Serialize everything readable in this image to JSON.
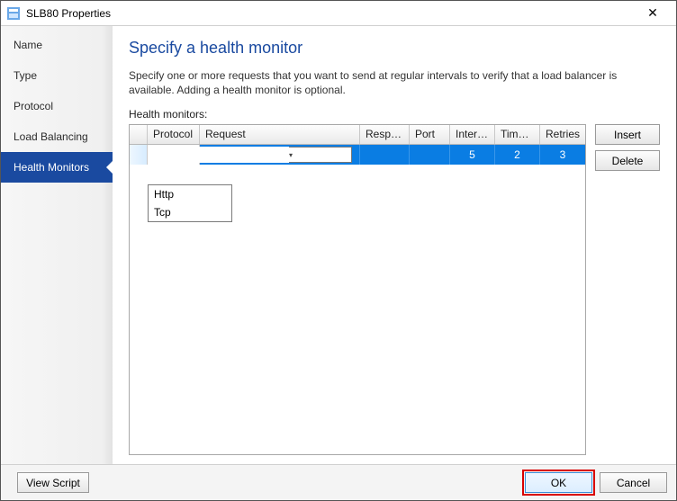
{
  "window": {
    "title": "SLB80 Properties"
  },
  "sidebar": {
    "items": [
      {
        "label": "Name",
        "active": false
      },
      {
        "label": "Type",
        "active": false
      },
      {
        "label": "Protocol",
        "active": false
      },
      {
        "label": "Load Balancing",
        "active": false
      },
      {
        "label": "Health Monitors",
        "active": true
      }
    ]
  },
  "page": {
    "title": "Specify a health monitor",
    "description": "Specify one or more requests that you want to send at regular intervals to verify that a load balancer is available. Adding a health monitor is optional.",
    "health_monitors_label": "Health monitors:"
  },
  "grid": {
    "columns": {
      "protocol": "Protocol",
      "request": "Request",
      "respo": "Respo...",
      "port": "Port",
      "interval": "Interval",
      "time": "Time-...",
      "retries": "Retries"
    },
    "row": {
      "protocol": "",
      "request": "",
      "respo": "",
      "port": "",
      "interval": "5",
      "time": "2",
      "retries": "3"
    },
    "protocol_options": [
      "Http",
      "Tcp"
    ]
  },
  "buttons": {
    "insert": "Insert",
    "delete": "Delete",
    "view_script": "View Script",
    "ok": "OK",
    "cancel": "Cancel"
  }
}
